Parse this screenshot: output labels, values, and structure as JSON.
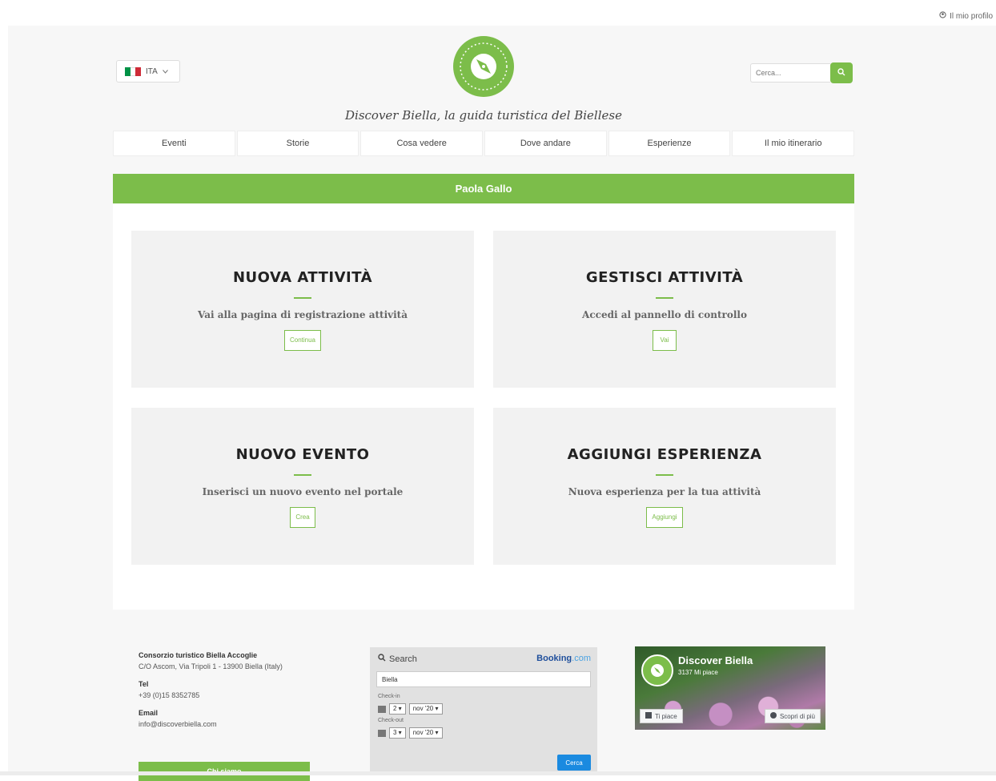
{
  "top": {
    "profile_label": "Il mio profilo"
  },
  "header": {
    "language": "ITA",
    "tagline": "Discover Biella, la guida turistica del Biellese",
    "search_placeholder": "Cerca..."
  },
  "nav": {
    "items": [
      {
        "label": "Eventi"
      },
      {
        "label": "Storie"
      },
      {
        "label": "Cosa vedere"
      },
      {
        "label": "Dove andare"
      },
      {
        "label": "Esperienze"
      },
      {
        "label": "Il mio itinerario"
      }
    ]
  },
  "main": {
    "title": "Paola Gallo",
    "cards": [
      {
        "title": "NUOVA ATTIVITÀ",
        "text": "Vai alla pagina di registrazione attività",
        "button": "Continua"
      },
      {
        "title": "GESTISCI ATTIVITÀ",
        "text": "Accedi al pannello di controllo",
        "button": "Vai"
      },
      {
        "title": "NUOVO EVENTO",
        "text": "Inserisci un nuovo evento nel portale",
        "button": "Crea"
      },
      {
        "title": "AGGIUNGI ESPERIENZA",
        "text": "Nuova esperienza per la tua attività",
        "button": "Aggiungi"
      }
    ]
  },
  "footer": {
    "org_name": "Consorzio turistico Biella Accoglie",
    "address": "C/O Ascom, Via Tripoli 1 - 13900 Biella (Italy)",
    "tel_label": "Tel",
    "tel": "+39 (0)15 8352785",
    "email_label": "Email",
    "email": "info@discoverbiella.com",
    "contact_button": "Chi siamo",
    "booking": {
      "search_label": "Search",
      "brand": "Booking",
      "brand_suffix": ".com",
      "destination": "Biella",
      "checkin_label": "Check-in",
      "checkin_day": "2",
      "checkin_month": "nov '20",
      "checkout_label": "Check-out",
      "checkout_day": "3",
      "checkout_month": "nov '20",
      "submit": "Cerca"
    },
    "facebook": {
      "page_name": "Discover Biella",
      "likes": "3137 Mi piace",
      "like_button": "Ti piace",
      "learn_button": "Scopri di più"
    }
  },
  "colors": {
    "accent": "#7cbd4a",
    "booking_blue": "#1a8ae0"
  },
  "icons": [
    "user-icon",
    "italy-flag-icon",
    "chevron-down-icon",
    "compass-logo",
    "search-icon",
    "calendar-icon",
    "facebook-like-icon",
    "info-icon"
  ]
}
